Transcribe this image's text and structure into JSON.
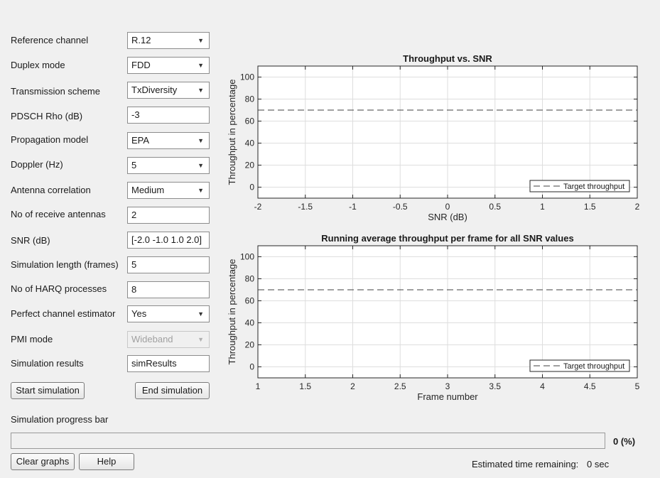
{
  "form": {
    "reference_channel": {
      "label": "Reference channel",
      "value": "R.12"
    },
    "duplex_mode": {
      "label": "Duplex mode",
      "value": "FDD"
    },
    "transmission_scheme": {
      "label": "Transmission scheme",
      "value": "TxDiversity"
    },
    "pdsch_rho": {
      "label": "PDSCH Rho (dB)",
      "value": "-3"
    },
    "propagation_model": {
      "label": "Propagation model",
      "value": "EPA"
    },
    "doppler": {
      "label": "Doppler (Hz)",
      "value": "5"
    },
    "antenna_correlation": {
      "label": "Antenna correlation",
      "value": "Medium"
    },
    "receive_antennas": {
      "label": "No of receive antennas",
      "value": "2"
    },
    "snr": {
      "label": "SNR (dB)",
      "value": "[-2.0 -1.0 1.0 2.0]"
    },
    "sim_length": {
      "label": "Simulation length (frames)",
      "value": "5"
    },
    "harq_processes": {
      "label": "No of HARQ processes",
      "value": "8"
    },
    "perfect_channel_estimator": {
      "label": "Perfect channel estimator",
      "value": "Yes"
    },
    "pmi_mode": {
      "label": "PMI mode",
      "value": "Wideband"
    },
    "sim_results": {
      "label": "Simulation results",
      "value": "simResults"
    }
  },
  "buttons": {
    "start": "Start simulation",
    "end": "End simulation",
    "clear": "Clear graphs",
    "help": "Help"
  },
  "progress": {
    "label": "Simulation progress bar",
    "percent": 0,
    "percent_text": "0 (%)",
    "eta_label": "Estimated time remaining:",
    "eta_value": "0 sec"
  },
  "icons": {
    "dropdown_arrow": "▼"
  },
  "colors": {
    "grid": "#dedede",
    "axis": "#262626",
    "target_line": "#404040"
  },
  "chart_data": [
    {
      "type": "line",
      "title": "Throughput vs. SNR",
      "xlabel": "SNR (dB)",
      "ylabel": "Throughput in percentage",
      "xlim": [
        -2,
        2
      ],
      "ylim": [
        -10,
        110
      ],
      "xticks": [
        -2,
        -1.5,
        -1,
        -0.5,
        0,
        0.5,
        1,
        1.5,
        2
      ],
      "yticks": [
        0,
        20,
        40,
        60,
        80,
        100
      ],
      "grid": true,
      "legend_position": "bottom-right",
      "series": [
        {
          "name": "Target throughput",
          "style": "dashed",
          "x": [
            -2,
            2
          ],
          "y": [
            70,
            70
          ]
        }
      ]
    },
    {
      "type": "line",
      "title": "Running average throughput per frame for all SNR values",
      "xlabel": "Frame number",
      "ylabel": "Throughput in percentage",
      "xlim": [
        1,
        5
      ],
      "ylim": [
        -10,
        110
      ],
      "xticks": [
        1,
        1.5,
        2,
        2.5,
        3,
        3.5,
        4,
        4.5,
        5
      ],
      "yticks": [
        0,
        20,
        40,
        60,
        80,
        100
      ],
      "grid": true,
      "legend_position": "bottom-right",
      "series": [
        {
          "name": "Target throughput",
          "style": "dashed",
          "x": [
            1,
            5
          ],
          "y": [
            70,
            70
          ]
        }
      ]
    }
  ]
}
